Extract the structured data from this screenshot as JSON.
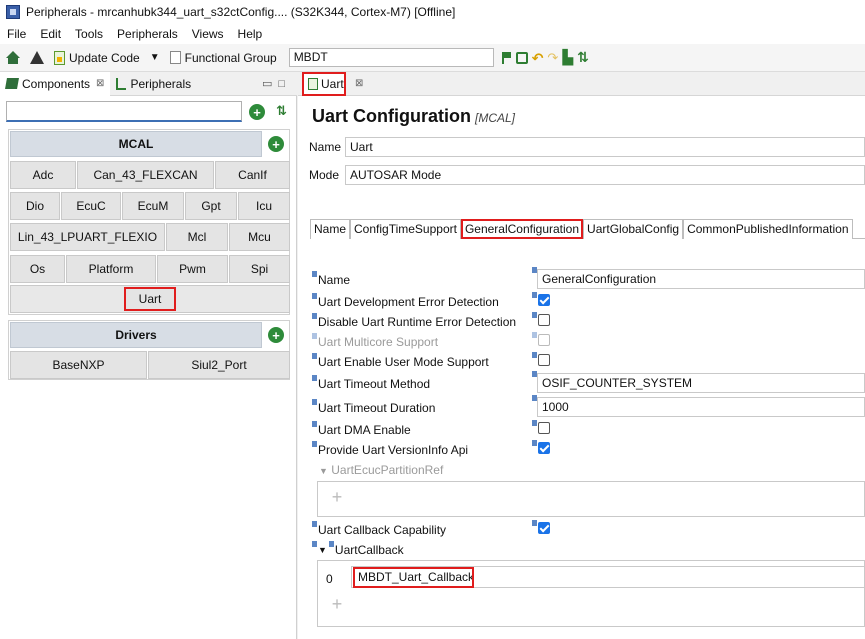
{
  "window": {
    "title": "Peripherals - mrcanhubk344_uart_s32ctConfig.... (S32K344, Cortex-M7) [Offline]"
  },
  "menu": [
    "File",
    "Edit",
    "Tools",
    "Peripherals",
    "Views",
    "Help"
  ],
  "toolbar": {
    "update_code": "Update Code",
    "functional_group_label": "Functional Group",
    "functional_group_value": "MBDT"
  },
  "left": {
    "tabs": [
      {
        "label": "Components",
        "icon": "components-icon"
      },
      {
        "label": "Peripherals",
        "icon": "usb-icon"
      }
    ],
    "search_value": "",
    "groups": [
      {
        "name": "MCAL",
        "rows": [
          [
            "Adc",
            "Can_43_FLEXCAN",
            "CanIf"
          ],
          [
            "Dio",
            "EcuC",
            "EcuM",
            "Gpt",
            "Icu"
          ],
          [
            "Lin_43_LPUART_FLEXIO",
            "Mcl",
            "Mcu"
          ],
          [
            "Os",
            "Platform",
            "Pwm",
            "Spi"
          ],
          [
            "Uart"
          ]
        ]
      },
      {
        "name": "Drivers",
        "rows": [
          [
            "BaseNXP",
            "Siul2_Port"
          ]
        ]
      }
    ]
  },
  "editor": {
    "tab_label": "Uart",
    "title": "Uart Configuration",
    "title_suffix": "[MCAL]",
    "name_label": "Name",
    "name_value": "Uart",
    "mode_label": "Mode",
    "mode_value": "AUTOSAR Mode",
    "config_tabs": [
      "Name",
      "ConfigTimeSupport",
      "GeneralConfiguration",
      "UartGlobalConfig",
      "CommonPublishedInformation"
    ],
    "active_config_tab": "GeneralConfiguration",
    "properties": {
      "name": {
        "label": "Name",
        "value": "GeneralConfiguration"
      },
      "dev_error": {
        "label": "Uart Development Error Detection",
        "checked": true
      },
      "disable_runtime": {
        "label": "Disable Uart Runtime Error Detection",
        "checked": false
      },
      "multicore": {
        "label": "Uart Multicore Support",
        "checked": false,
        "disabled": true
      },
      "user_mode": {
        "label": "Uart Enable User Mode Support",
        "checked": false
      },
      "timeout_method": {
        "label": "Uart Timeout Method",
        "value": "OSIF_COUNTER_SYSTEM"
      },
      "timeout_duration": {
        "label": "Uart Timeout Duration",
        "value": "1000"
      },
      "dma_enable": {
        "label": "Uart DMA Enable",
        "checked": false
      },
      "version_info": {
        "label": "Provide Uart VersionInfo Api",
        "checked": true
      },
      "partition_ref": {
        "label": "UartEcucPartitionRef"
      },
      "callback_capability": {
        "label": "Uart Callback Capability",
        "checked": true
      },
      "callback": {
        "label": "UartCallback",
        "index": "0",
        "value": "MBDT_Uart_Callback"
      }
    }
  }
}
